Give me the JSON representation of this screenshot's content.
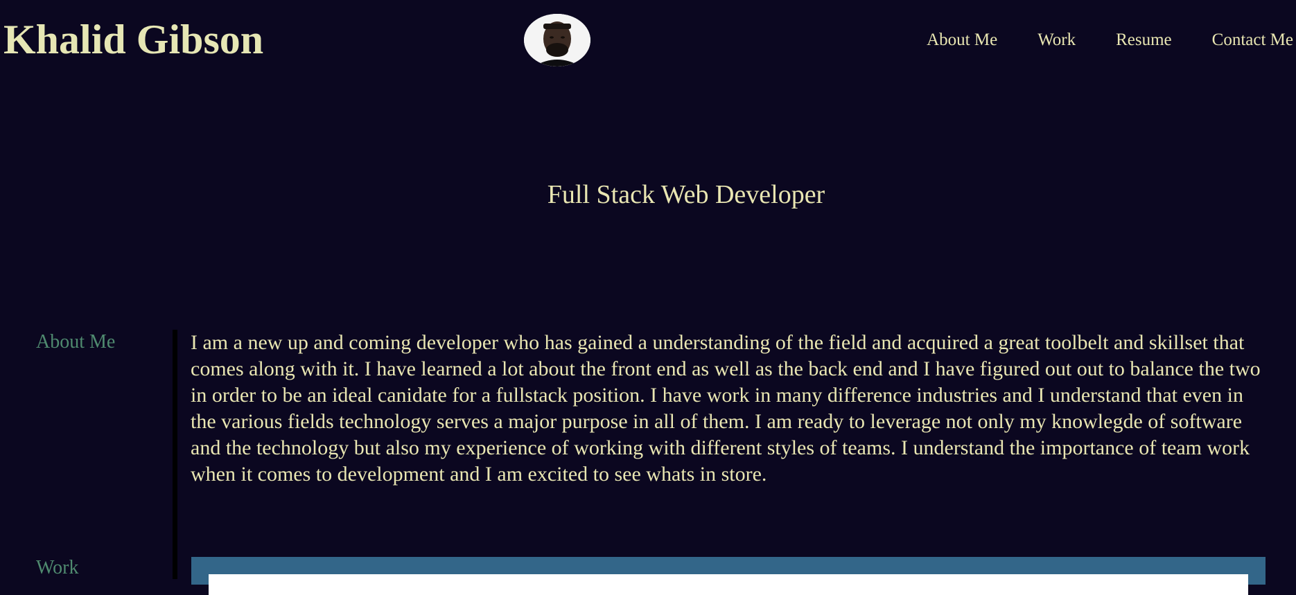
{
  "header": {
    "site_name": "Khalid Gibson",
    "avatar_icon": "profile-photo",
    "nav": [
      {
        "label": "About Me"
      },
      {
        "label": "Work"
      },
      {
        "label": "Resume"
      },
      {
        "label": "Contact Me"
      }
    ]
  },
  "hero": {
    "tagline": "Full Stack Web Developer"
  },
  "about": {
    "label": "About Me",
    "text": "I am a new up and coming developer who has gained a understanding of the field and acquired a great toolbelt and skillset that comes along with it. I have learned a lot about the front end as well as the back end and I have figured out out to balance the two in order to be an ideal canidate for a fullstack position. I have work in many difference industries and I understand that even in the various fields technology serves a major purpose in all of them. I am ready to leverage not only my knowlegde of software and the technology but also my experience of working with different styles of teams. I understand the importance of team work when it comes to development and I am excited to see whats in store."
  },
  "work": {
    "label": "Work"
  },
  "colors": {
    "background": "#0b0720",
    "text": "#e9e6b2",
    "section_label": "#4f8a6f",
    "work_panel": "#336689"
  }
}
